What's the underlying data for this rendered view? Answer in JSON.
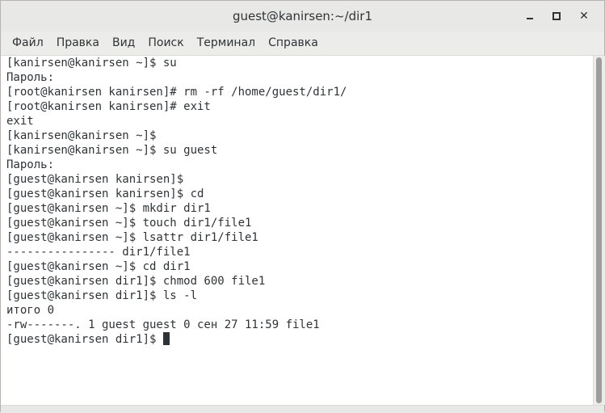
{
  "window": {
    "title": "guest@kanirsen:~/dir1",
    "minimize_icon": "minimize-icon",
    "maximize_icon": "maximize-icon",
    "close_icon": "close-icon",
    "close_glyph": "✕"
  },
  "menubar": {
    "items": [
      {
        "label": "Файл"
      },
      {
        "label": "Правка"
      },
      {
        "label": "Вид"
      },
      {
        "label": "Поиск"
      },
      {
        "label": "Терминал"
      },
      {
        "label": "Справка"
      }
    ]
  },
  "terminal": {
    "lines": [
      "[kanirsen@kanirsen ~]$ su",
      "Пароль:",
      "[root@kanirsen kanirsen]# rm -rf /home/guest/dir1/",
      "[root@kanirsen kanirsen]# exit",
      "exit",
      "[kanirsen@kanirsen ~]$",
      "[kanirsen@kanirsen ~]$ su guest",
      "Пароль:",
      "[guest@kanirsen kanirsen]$",
      "[guest@kanirsen kanirsen]$ cd",
      "[guest@kanirsen ~]$ mkdir dir1",
      "[guest@kanirsen ~]$ touch dir1/file1",
      "[guest@kanirsen ~]$ lsattr dir1/file1",
      "---------------- dir1/file1",
      "[guest@kanirsen ~]$ cd dir1",
      "[guest@kanirsen dir1]$ chmod 600 file1",
      "[guest@kanirsen dir1]$ ls -l",
      "итого 0",
      "-rw-------. 1 guest guest 0 сен 27 11:59 file1"
    ],
    "prompt": "[guest@kanirsen dir1]$ "
  }
}
